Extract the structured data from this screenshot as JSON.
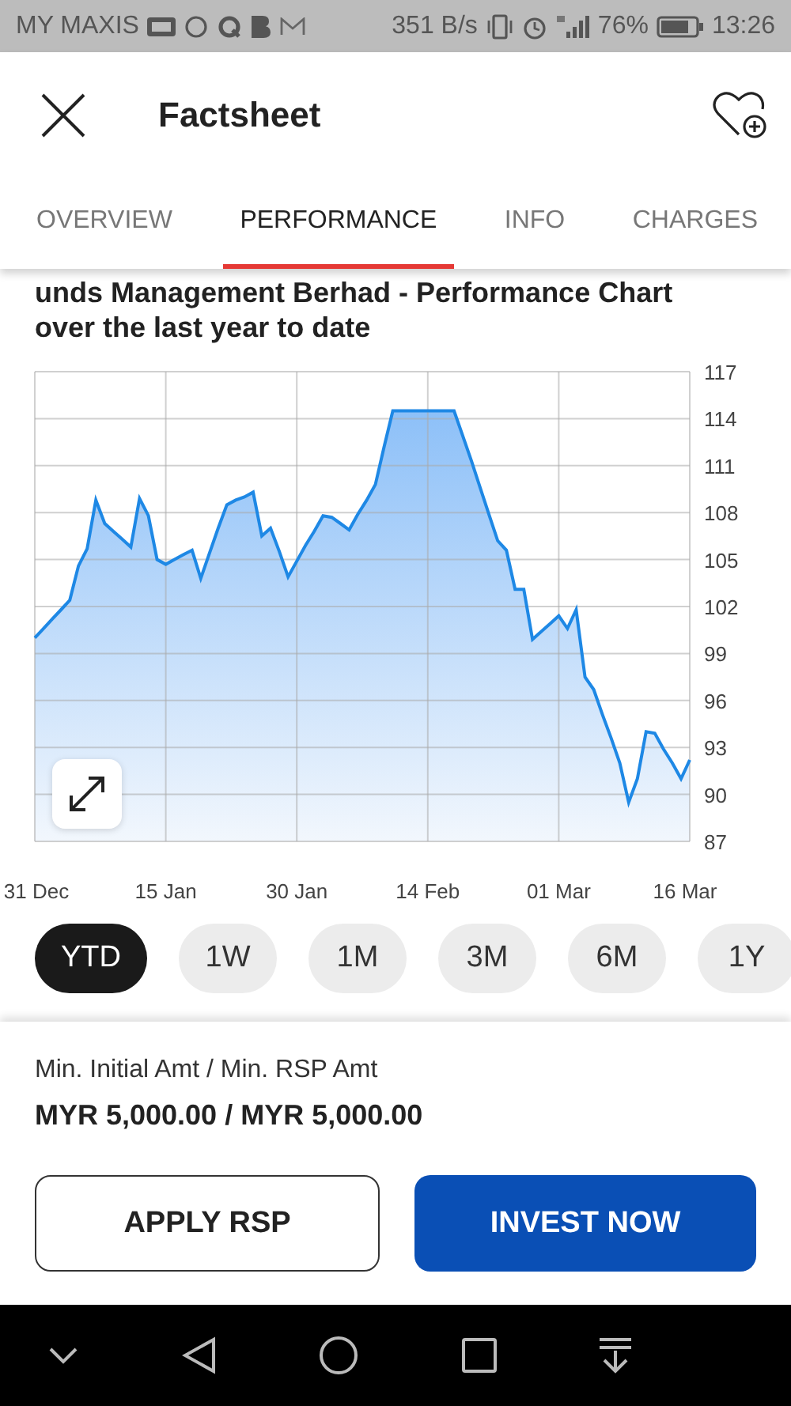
{
  "status_bar": {
    "carrier": "MY MAXIS",
    "speed": "351 B/s",
    "battery": "76%",
    "time": "13:26"
  },
  "header": {
    "title": "Factsheet"
  },
  "tabs": [
    {
      "label": "OVERVIEW",
      "selected": false
    },
    {
      "label": "PERFORMANCE",
      "selected": true
    },
    {
      "label": "INFO",
      "selected": false
    },
    {
      "label": "CHARGES",
      "selected": false
    }
  ],
  "chart_title_cut": "unds Management Berhad - Performance Chart",
  "chart_title": "over the last year to date",
  "chart": {
    "chart_data": {
      "type": "area",
      "categories": [
        "31 Dec",
        null,
        null,
        null,
        null,
        null,
        null,
        null,
        null,
        null,
        null,
        null,
        null,
        null,
        null,
        "15 Jan",
        null,
        null,
        null,
        null,
        null,
        null,
        null,
        null,
        null,
        null,
        null,
        null,
        null,
        null,
        "30 Jan",
        null,
        null,
        null,
        null,
        null,
        null,
        null,
        null,
        null,
        null,
        null,
        null,
        null,
        null,
        "14 Feb",
        null,
        null,
        null,
        null,
        null,
        null,
        null,
        null,
        null,
        null,
        null,
        null,
        null,
        null,
        "01 Mar",
        null,
        null,
        null,
        null,
        null,
        null,
        null,
        null,
        null,
        null,
        null,
        null,
        null,
        null,
        "16 Mar"
      ],
      "series": [
        {
          "color": "#1e88e5",
          "values": [
            100.0,
            100.6,
            101.2,
            101.8,
            102.4,
            104.6,
            105.7,
            108.8,
            107.3,
            106.8,
            106.3,
            105.8,
            108.9,
            107.8,
            105.0,
            104.7,
            105.0,
            105.3,
            105.6,
            103.8,
            105.4,
            107.0,
            108.5,
            108.8,
            109.0,
            109.3,
            106.5,
            107.0,
            105.5,
            103.9,
            104.9,
            105.9,
            106.8,
            107.8,
            107.7,
            107.3,
            106.9,
            107.9,
            108.8,
            109.8,
            112.2,
            114.5,
            114.5,
            114.5,
            114.5,
            114.5,
            114.5,
            114.5,
            114.5,
            112.9,
            111.3,
            109.6,
            107.9,
            106.2,
            105.6,
            103.1,
            103.1,
            99.9,
            100.4,
            100.9,
            101.4,
            100.6,
            101.8,
            97.5,
            96.7,
            95.1,
            93.6,
            92.0,
            89.5,
            91.0,
            94.0,
            93.9,
            92.9,
            92.0,
            91.0,
            92.2
          ]
        }
      ],
      "grid": true,
      "ylim": [
        87,
        117
      ],
      "yticks": [
        87,
        90,
        93,
        96,
        99,
        102,
        105,
        108,
        111,
        114,
        117
      ]
    }
  },
  "periods": [
    {
      "label": "YTD",
      "selected": true
    },
    {
      "label": "1W",
      "selected": false
    },
    {
      "label": "1M",
      "selected": false
    },
    {
      "label": "3M",
      "selected": false
    },
    {
      "label": "6M",
      "selected": false
    },
    {
      "label": "1Y",
      "selected": false
    }
  ],
  "minimum": {
    "label": "Min. Initial Amt / Min. RSP Amt",
    "value": "MYR 5,000.00 / MYR 5,000.00"
  },
  "buttons": [
    {
      "label": "APPLY RSP",
      "kind": "outline"
    },
    {
      "label": "INVEST NOW",
      "kind": "primary"
    }
  ]
}
